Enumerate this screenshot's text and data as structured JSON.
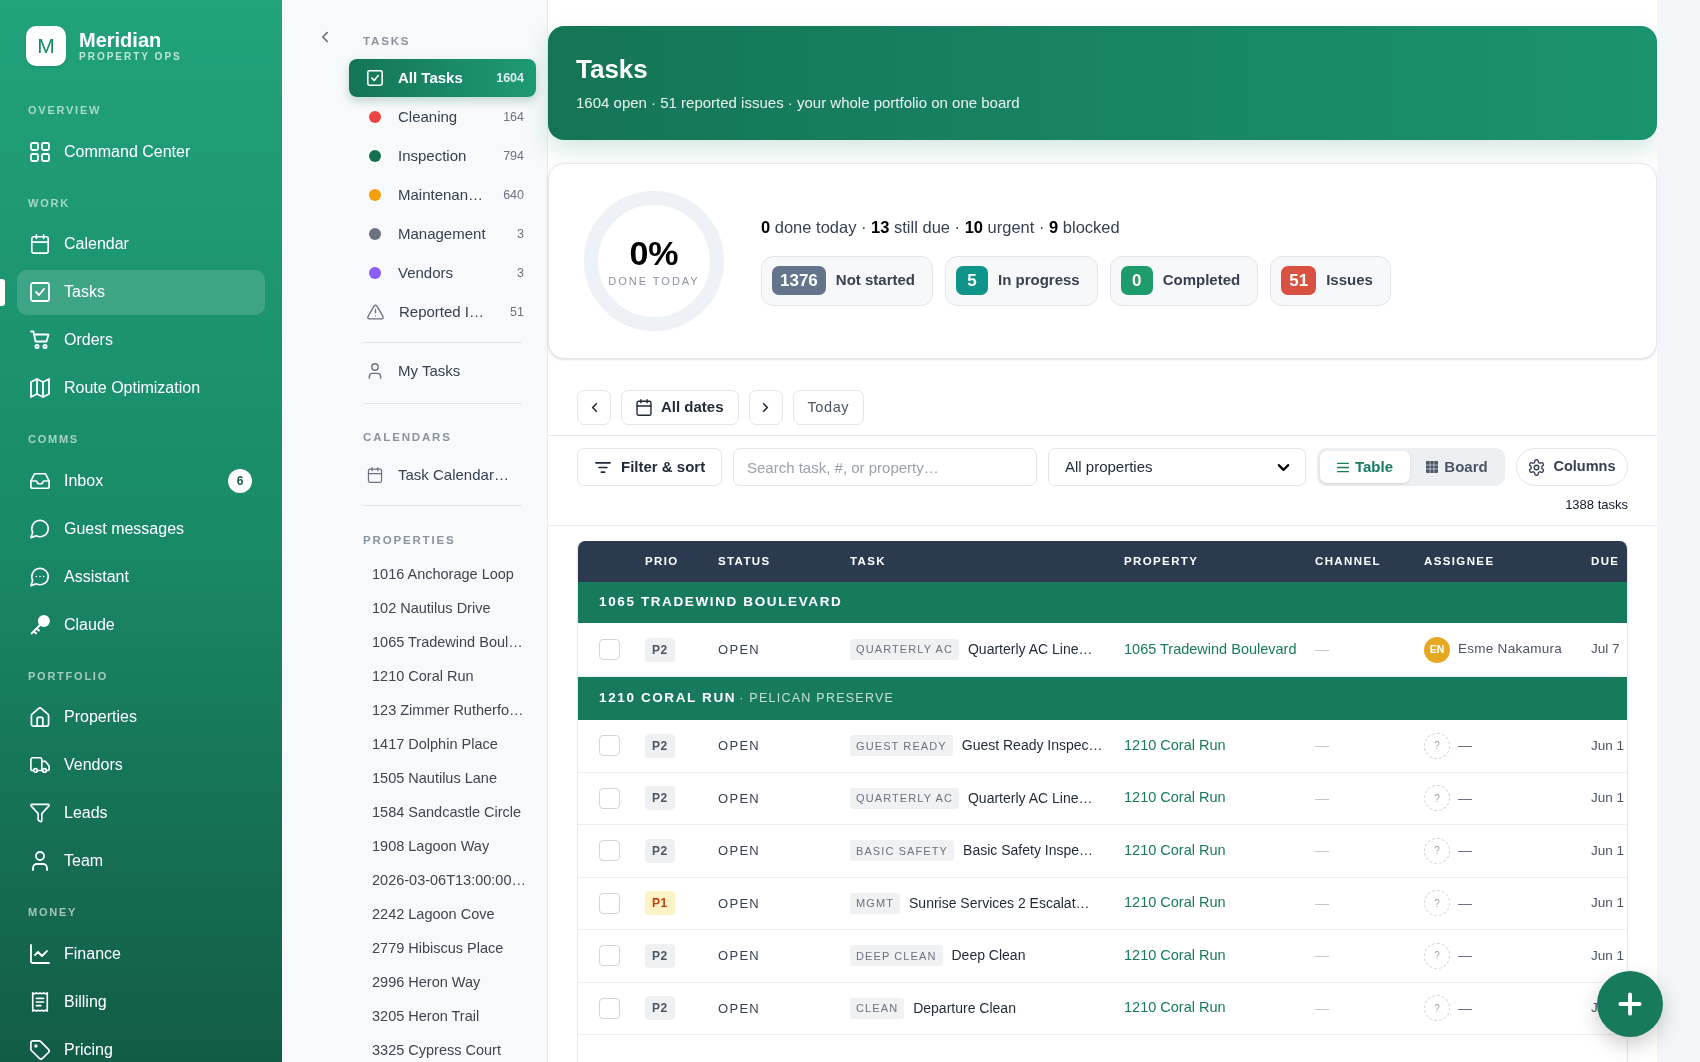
{
  "brand": {
    "mark": "M",
    "name": "Meridian",
    "tagline": "PROPERTY OPS"
  },
  "sidebar": {
    "sections": [
      {
        "label": "OVERVIEW",
        "items": [
          {
            "label": "Command Center",
            "selected": false
          }
        ]
      },
      {
        "label": "WORK",
        "items": [
          {
            "label": "Calendar",
            "selected": false
          },
          {
            "label": "Tasks",
            "selected": true
          },
          {
            "label": "Orders",
            "selected": false
          },
          {
            "label": "Route Optimization",
            "selected": false
          }
        ]
      },
      {
        "label": "COMMS",
        "items": [
          {
            "label": "Inbox",
            "selected": false,
            "badge": "6"
          },
          {
            "label": "Guest messages",
            "selected": false
          },
          {
            "label": "Assistant",
            "selected": false
          },
          {
            "label": "Claude",
            "selected": false
          }
        ]
      },
      {
        "label": "PORTFOLIO",
        "items": [
          {
            "label": "Properties",
            "selected": false
          },
          {
            "label": "Vendors",
            "selected": false
          },
          {
            "label": "Leads",
            "selected": false
          },
          {
            "label": "Team",
            "selected": false
          }
        ]
      },
      {
        "label": "MONEY",
        "items": [
          {
            "label": "Finance",
            "selected": false
          },
          {
            "label": "Billing",
            "selected": false
          },
          {
            "label": "Pricing",
            "selected": false
          }
        ]
      }
    ]
  },
  "task_nav": {
    "tasks_label": "TASKS",
    "categories": [
      {
        "kind": "all",
        "label": "All Tasks",
        "count": "1604",
        "selected": true
      },
      {
        "kind": "dot",
        "label": "Cleaning",
        "count": "164",
        "color": "#ef4444",
        "selected": false
      },
      {
        "kind": "dot",
        "label": "Inspection",
        "count": "794",
        "color": "#16704f",
        "selected": false
      },
      {
        "kind": "dot",
        "label": "Maintenan…",
        "count": "640",
        "color": "#f59e0b",
        "selected": false
      },
      {
        "kind": "dot",
        "label": "Management",
        "count": "3",
        "color": "#6b7280",
        "selected": false
      },
      {
        "kind": "dot",
        "label": "Vendors",
        "count": "3",
        "color": "#8b5cf6",
        "selected": false
      },
      {
        "kind": "issues",
        "label": "Reported I…",
        "count": "51",
        "selected": false
      }
    ],
    "my_tasks": {
      "label": "My Tasks",
      "selected": false
    },
    "calendars_label": "CALENDARS",
    "calendars": [
      {
        "label": "Task Calendar…",
        "selected": false
      }
    ],
    "properties_label": "PROPERTIES",
    "properties": [
      {
        "label": "1016 Anchorage Loop",
        "selected": false
      },
      {
        "label": "102 Nautilus Drive",
        "selected": false
      },
      {
        "label": "1065 Tradewind Boul…",
        "selected": false
      },
      {
        "label": "1210 Coral Run",
        "selected": false
      },
      {
        "label": "123 Zimmer Rutherfo…",
        "selected": false
      },
      {
        "label": "1417 Dolphin Place",
        "selected": false
      },
      {
        "label": "1505 Nautilus Lane",
        "selected": false
      },
      {
        "label": "1584 Sandcastle Circle",
        "selected": false
      },
      {
        "label": "1908 Lagoon Way",
        "selected": false
      },
      {
        "label": "2026-03-06T13:00:00…",
        "selected": false
      },
      {
        "label": "2242 Lagoon Cove",
        "selected": false
      },
      {
        "label": "2779 Hibiscus Place",
        "selected": false
      },
      {
        "label": "2996 Heron Way",
        "selected": false
      },
      {
        "label": "3205 Heron Trail",
        "selected": false
      },
      {
        "label": "3325 Cypress Court",
        "selected": false
      }
    ]
  },
  "header": {
    "title": "Tasks",
    "subtitle": "1604 open · 51 reported issues · your whole portfolio on one board"
  },
  "progress": {
    "value": "0%",
    "label": "DONE TODAY",
    "level": 0
  },
  "summary": "**0** done today · **13** still due · **10** urgent · **9** blocked",
  "status_chips": [
    {
      "count": "1376",
      "label": "Not started",
      "color": "#64748b"
    },
    {
      "count": "5",
      "label": "In progress",
      "color": "#0f948a"
    },
    {
      "count": "0",
      "label": "Completed",
      "color": "#1e9c6c"
    },
    {
      "count": "51",
      "label": "Issues",
      "color": "#d95140"
    }
  ],
  "date_nav": {
    "range": "All dates",
    "today": "Today"
  },
  "filters": {
    "filter_button": "Filter & sort",
    "search": {
      "placeholder": "Search task, #, or property…"
    },
    "property_select": "All properties",
    "views": [
      {
        "label": "Table",
        "selected": true
      },
      {
        "label": "Board",
        "selected": false
      }
    ],
    "columns_button": "Columns",
    "count": "1388 tasks"
  },
  "table": {
    "columns": [
      "PRIO",
      "STATUS",
      "TASK",
      "PROPERTY",
      "CHANNEL",
      "ASSIGNEE",
      "DUE"
    ],
    "groups": [
      {
        "title": "1065 TRADEWIND BOULEVARD",
        "rows": [
          {
            "checked": false,
            "priority": {
              "label": "P2",
              "kind": "normal"
            },
            "status": "OPEN",
            "tag": "QUARTERLY AC",
            "task": "Quarterly AC Line…",
            "property": "1065 Tradewind Boulevard",
            "channel": "—",
            "assignee": {
              "kind": "person",
              "initials": "EN",
              "name": "Esme Nakamura"
            },
            "due": "Jul 7"
          }
        ]
      },
      {
        "title": "1210 CORAL RUN",
        "subtitle": "· PELICAN PRESERVE",
        "rows": [
          {
            "checked": false,
            "priority": {
              "label": "P2",
              "kind": "normal"
            },
            "status": "OPEN",
            "tag": "GUEST READY",
            "task": "Guest Ready Inspec…",
            "property": "1210 Coral Run",
            "channel": "—",
            "assignee": {
              "kind": "none",
              "initials": "?",
              "name": "—"
            },
            "due": "Jun 1"
          },
          {
            "checked": false,
            "priority": {
              "label": "P2",
              "kind": "normal"
            },
            "status": "OPEN",
            "tag": "QUARTERLY AC",
            "task": "Quarterly AC Line…",
            "property": "1210 Coral Run",
            "channel": "—",
            "assignee": {
              "kind": "none",
              "initials": "?",
              "name": "—"
            },
            "due": "Jun 1"
          },
          {
            "checked": false,
            "priority": {
              "label": "P2",
              "kind": "normal"
            },
            "status": "OPEN",
            "tag": "BASIC SAFETY",
            "task": "Basic Safety Inspe…",
            "property": "1210 Coral Run",
            "channel": "—",
            "assignee": {
              "kind": "none",
              "initials": "?",
              "name": "—"
            },
            "due": "Jun 1"
          },
          {
            "checked": false,
            "priority": {
              "label": "P1",
              "kind": "high"
            },
            "status": "OPEN",
            "tag": "MGMT",
            "task": "Sunrise Services 2 Escalat…",
            "property": "1210 Coral Run",
            "channel": "—",
            "assignee": {
              "kind": "none",
              "initials": "?",
              "name": "—"
            },
            "due": "Jun 1"
          },
          {
            "checked": false,
            "priority": {
              "label": "P2",
              "kind": "normal"
            },
            "status": "OPEN",
            "tag": "DEEP CLEAN",
            "task": "Deep Clean",
            "property": "1210 Coral Run",
            "channel": "—",
            "assignee": {
              "kind": "none",
              "initials": "?",
              "name": "—"
            },
            "due": "Jun 1"
          },
          {
            "checked": false,
            "priority": {
              "label": "P2",
              "kind": "normal"
            },
            "status": "OPEN",
            "tag": "CLEAN",
            "task": "Departure Clean",
            "property": "1210 Coral Run",
            "channel": "—",
            "assignee": {
              "kind": "none",
              "initials": "?",
              "name": "—"
            },
            "due": "J"
          }
        ]
      }
    ]
  }
}
